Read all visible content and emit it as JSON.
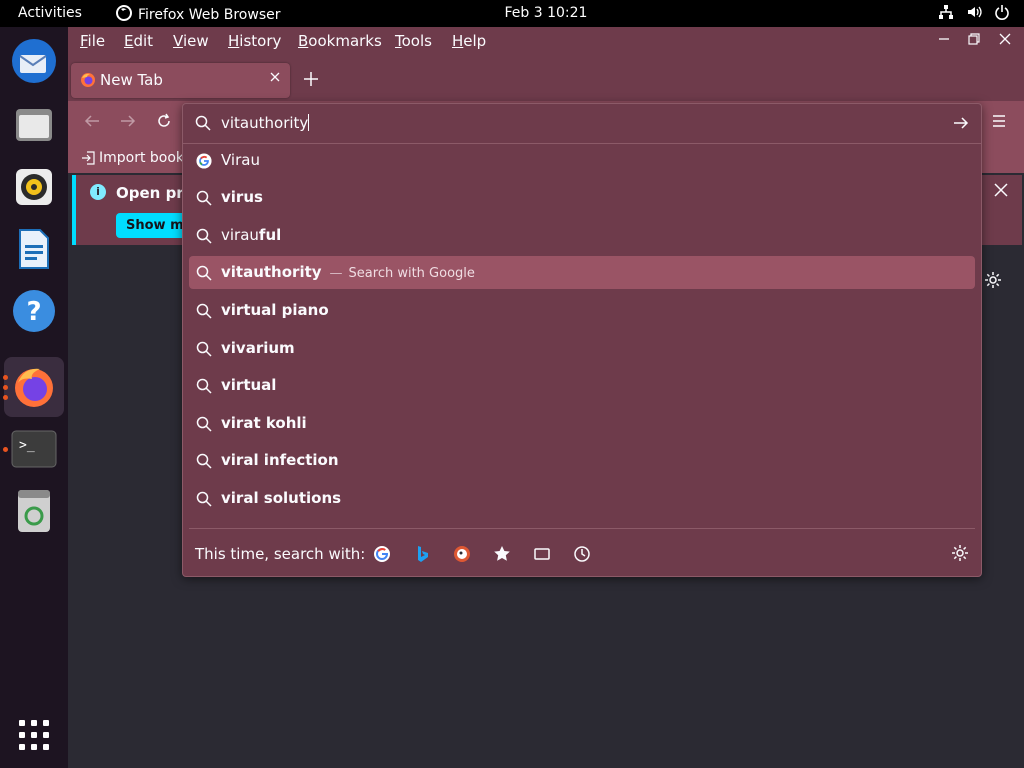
{
  "topbar": {
    "activities": "Activities",
    "app_name": "Firefox Web Browser",
    "clock": "Feb 3  10:21"
  },
  "menubar": {
    "items": [
      {
        "first": "F",
        "rest": "ile"
      },
      {
        "first": "E",
        "rest": "dit"
      },
      {
        "first": "V",
        "rest": "iew"
      },
      {
        "first": "H",
        "rest": "istory"
      },
      {
        "first": "B",
        "rest": "ookmarks"
      },
      {
        "first": "T",
        "rest": "ools"
      },
      {
        "first": "H",
        "rest": "elp"
      }
    ]
  },
  "tab": {
    "title": "New Tab"
  },
  "bookmarks": {
    "import": "Import book"
  },
  "notice": {
    "message": "Open prev",
    "button": "Show me"
  },
  "urlbar": {
    "value": "vitauthority"
  },
  "suggestions": [
    {
      "icon": "google-icon",
      "plain": "Virau",
      "bold": "",
      "desc": ""
    },
    {
      "icon": "search-icon",
      "plain": "",
      "bold": "virus",
      "desc": ""
    },
    {
      "icon": "search-icon",
      "plain": "virau",
      "bold": "ful",
      "desc": ""
    },
    {
      "icon": "search-icon",
      "plain": "",
      "bold": "vitauthority",
      "desc": "Search with Google",
      "separator": "—",
      "selected": true
    },
    {
      "icon": "search-icon",
      "plain": "",
      "bold": "virtual piano",
      "desc": ""
    },
    {
      "icon": "search-icon",
      "plain": "",
      "bold": "vivarium",
      "desc": ""
    },
    {
      "icon": "search-icon",
      "plain": "",
      "bold": "virtual",
      "desc": ""
    },
    {
      "icon": "search-icon",
      "plain": "",
      "bold": "virat kohli",
      "desc": ""
    },
    {
      "icon": "search-icon",
      "plain": "",
      "bold": "viral infection",
      "desc": ""
    },
    {
      "icon": "search-icon",
      "plain": "",
      "bold": "viral solutions",
      "desc": ""
    }
  ],
  "oneoff": {
    "label": "This time, search with:",
    "engines": [
      "google-icon",
      "bing-icon",
      "duckduckgo-icon",
      "bookmarks-star-icon",
      "tabs-icon",
      "history-clock-icon"
    ]
  },
  "colors": {
    "menubar": "#6e3b4b",
    "toolbar": "#8c4c5d",
    "selected_row": "#9a5465",
    "accent": "#00ddff"
  }
}
